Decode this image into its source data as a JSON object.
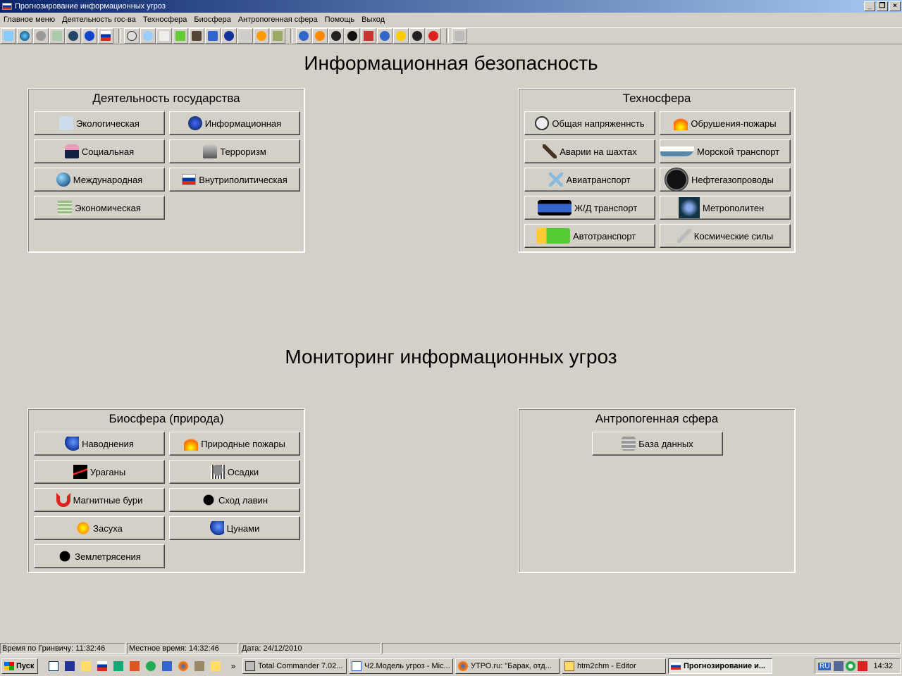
{
  "window": {
    "title": "Прогнозирование информационных угроз"
  },
  "menu": [
    "Главное меню",
    "Деятельность гос-ва",
    "Техносфера",
    "Биосфера",
    "Антропогенная сфера",
    "Помощь",
    "Выход"
  ],
  "headings": {
    "top": "Информационная безопасность",
    "bottom": "Мониторинг информационных угроз"
  },
  "panels": {
    "gov": {
      "title": "Деятельность государства",
      "buttons": [
        "Экологическая",
        "Информационная",
        "Социальная",
        "Терроризм",
        "Международная",
        "Внутриполитическая",
        "Экономическая"
      ]
    },
    "tech": {
      "title": "Техносфера",
      "buttons": [
        "Общая напряженнсть",
        "Обрушения-пожары",
        "Аварии на шахтах",
        "Морской транспорт",
        "Авиатранспорт",
        "Нефтегазопроводы",
        "Ж/Д транспорт",
        "Метрополитен",
        "Автотранспорт",
        "Космические силы"
      ]
    },
    "bio": {
      "title": "Биосфера (природа)",
      "buttons": [
        "Наводнения",
        "Природные пожары",
        "Ураганы",
        "Осадки",
        "Магнитные бури",
        "Сход лавин",
        "Засуха",
        "Цунами",
        "Землетрясения"
      ]
    },
    "anthro": {
      "title": "Антропогенная сфера",
      "buttons": [
        "База данных"
      ]
    }
  },
  "status": {
    "gmt": "Время по Гринвичу: 11:32:46",
    "local": "Местное время: 14:32:46",
    "date": "Дата: 24/12/2010"
  },
  "taskbar": {
    "start": "Пуск",
    "chevron": "»",
    "tasks": [
      "Total Commander 7.02...",
      "Ч2.Модель угроз - Mic...",
      "УТРО.ru: \"Барак, отд...",
      "htm2chm - Editor",
      "Прогнозирование и..."
    ],
    "lang": "RU",
    "clock": "14:32"
  },
  "colors": {
    "titlebar": "#0a246a",
    "face": "#d4d0c8"
  }
}
